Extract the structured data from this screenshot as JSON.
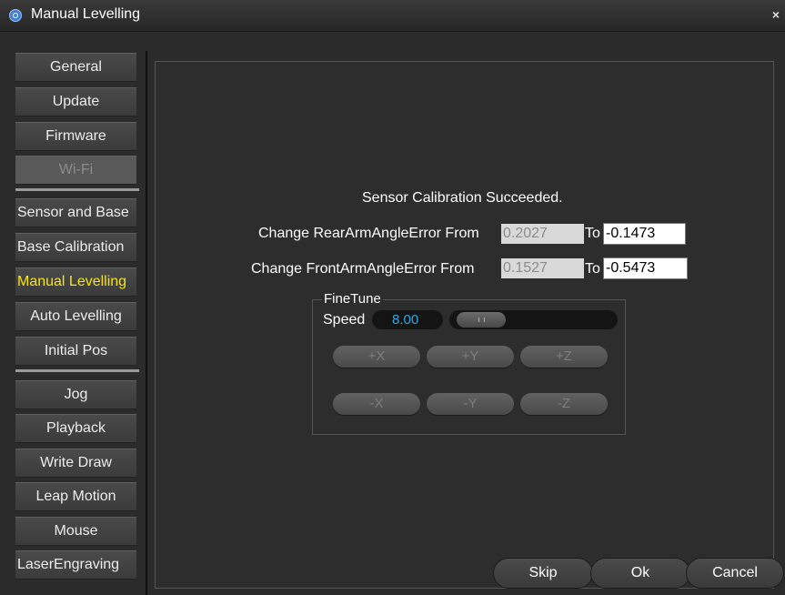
{
  "window": {
    "title": "Manual Levelling",
    "close_glyph": "×"
  },
  "sidebar": {
    "items": [
      {
        "label": "General"
      },
      {
        "label": "Update"
      },
      {
        "label": "Firmware"
      },
      {
        "label": "Wi-Fi",
        "state": "disabled"
      },
      {
        "label": "Sensor and Base"
      },
      {
        "label": "Base Calibration"
      },
      {
        "label": "Manual Levelling",
        "state": "active"
      },
      {
        "label": "Auto Levelling"
      },
      {
        "label": "Initial Pos"
      },
      {
        "label": "Jog"
      },
      {
        "label": "Playback"
      },
      {
        "label": "Write  Draw"
      },
      {
        "label": "Leap Motion"
      },
      {
        "label": "Mouse"
      },
      {
        "label": "LaserEngraving"
      }
    ]
  },
  "main": {
    "status": "Sensor Calibration Succeeded.",
    "rear": {
      "label": "Change RearArmAngleError From",
      "from": "0.2027",
      "to_label": "To",
      "to": "-0.1473"
    },
    "front": {
      "label": "Change FrontArmAngleError From",
      "from": "0.1527",
      "to_label": "To",
      "to": "-0.5473"
    },
    "finetune": {
      "title": "FineTune",
      "speed_label": "Speed",
      "speed_value": "8.00",
      "buttons_plus": [
        "+X",
        "+Y",
        "+Z"
      ],
      "buttons_minus": [
        "-X",
        "-Y",
        "-Z"
      ]
    }
  },
  "footer": {
    "skip": "Skip",
    "ok": "Ok",
    "cancel": "Cancel"
  },
  "colors": {
    "active_nav": "#f5e50a",
    "speed_value": "#2ea8e6"
  },
  "icons": {
    "app": "app-logo-icon",
    "close": "close-icon"
  }
}
